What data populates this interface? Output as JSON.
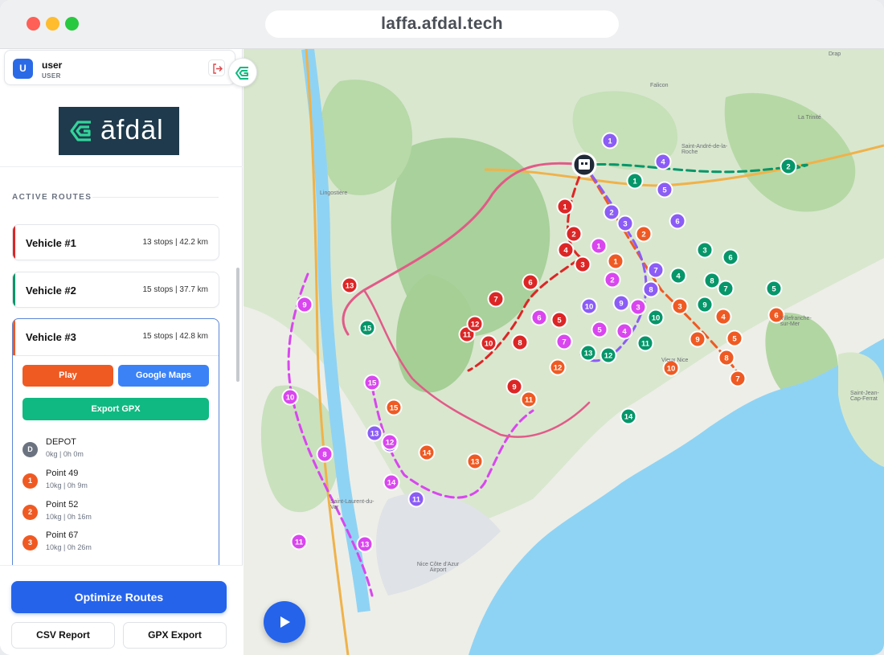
{
  "browser": {
    "url": "laffa.afdal.tech"
  },
  "user": {
    "initial": "U",
    "name": "user",
    "role": "USER"
  },
  "logo": {
    "text": "āfdāl"
  },
  "sidebar": {
    "section_title": "ACTIVE ROUTES",
    "routes": [
      {
        "name": "Vehicle #1",
        "meta": "13 stops | 42.2 km",
        "color": "#dc2626"
      },
      {
        "name": "Vehicle #2",
        "meta": "15 stops | 37.7 km",
        "color": "#059669"
      },
      {
        "name": "Vehicle #3",
        "meta": "15 stops | 42.8 km",
        "color": "#ef5a23"
      }
    ],
    "expanded": {
      "play_label": "Play",
      "gmaps_label": "Google Maps",
      "export_label": "Export GPX",
      "stops": [
        {
          "badge": "D",
          "name": "DEPOT",
          "detail": "0kg | 0h 0m",
          "color": "#6b7280"
        },
        {
          "badge": "1",
          "name": "Point 49",
          "detail": "10kg | 0h 9m",
          "color": "#ef5a23"
        },
        {
          "badge": "2",
          "name": "Point 52",
          "detail": "10kg | 0h 16m",
          "color": "#ef5a23"
        },
        {
          "badge": "3",
          "name": "Point 67",
          "detail": "10kg | 0h 26m",
          "color": "#ef5a23"
        }
      ]
    }
  },
  "actions": {
    "optimize_label": "Optimize Routes",
    "csv_label": "CSV Report",
    "gpx_label": "GPX Export"
  },
  "map": {
    "labels": [
      "Drap",
      "Falicon",
      "Saint-André-de-la-Roche",
      "La Trinité",
      "Lingostière",
      "Villefranche-sur-Mer",
      "Saint-Jean-Cap-Ferrat",
      "Nice Côte d'Azur Airport",
      "Saint-Laurent-du-Var",
      "Vieux Nice"
    ],
    "colors": {
      "red": "#dc2626",
      "green": "#059669",
      "orange": "#ef5a23",
      "purple": "#8b5cf6",
      "magenta": "#d946ef",
      "sea": "#8fd3f4"
    },
    "markers": [
      {
        "n": "1",
        "c": "red"
      },
      {
        "n": "2",
        "c": "red"
      },
      {
        "n": "3",
        "c": "red"
      },
      {
        "n": "4",
        "c": "red"
      },
      {
        "n": "5",
        "c": "red"
      },
      {
        "n": "6",
        "c": "red"
      },
      {
        "n": "7",
        "c": "red"
      },
      {
        "n": "8",
        "c": "red"
      },
      {
        "n": "9",
        "c": "red"
      },
      {
        "n": "10",
        "c": "red"
      },
      {
        "n": "11",
        "c": "red"
      },
      {
        "n": "12",
        "c": "red"
      },
      {
        "n": "13",
        "c": "red"
      },
      {
        "n": "1",
        "c": "green"
      },
      {
        "n": "2",
        "c": "green"
      },
      {
        "n": "3",
        "c": "green"
      },
      {
        "n": "4",
        "c": "green"
      },
      {
        "n": "5",
        "c": "green"
      },
      {
        "n": "6",
        "c": "green"
      },
      {
        "n": "7",
        "c": "green"
      },
      {
        "n": "8",
        "c": "green"
      },
      {
        "n": "9",
        "c": "green"
      },
      {
        "n": "10",
        "c": "green"
      },
      {
        "n": "11",
        "c": "green"
      },
      {
        "n": "12",
        "c": "green"
      },
      {
        "n": "13",
        "c": "green"
      },
      {
        "n": "14",
        "c": "green"
      },
      {
        "n": "15",
        "c": "green"
      },
      {
        "n": "1",
        "c": "orange"
      },
      {
        "n": "2",
        "c": "orange"
      },
      {
        "n": "3",
        "c": "orange"
      },
      {
        "n": "4",
        "c": "orange"
      },
      {
        "n": "5",
        "c": "orange"
      },
      {
        "n": "6",
        "c": "orange"
      },
      {
        "n": "7",
        "c": "orange"
      },
      {
        "n": "8",
        "c": "orange"
      },
      {
        "n": "9",
        "c": "orange"
      },
      {
        "n": "10",
        "c": "orange"
      },
      {
        "n": "11",
        "c": "orange"
      },
      {
        "n": "12",
        "c": "orange"
      },
      {
        "n": "13",
        "c": "orange"
      },
      {
        "n": "14",
        "c": "orange"
      },
      {
        "n": "15",
        "c": "orange"
      },
      {
        "n": "1",
        "c": "purple"
      },
      {
        "n": "2",
        "c": "purple"
      },
      {
        "n": "3",
        "c": "purple"
      },
      {
        "n": "4",
        "c": "purple"
      },
      {
        "n": "5",
        "c": "purple"
      },
      {
        "n": "6",
        "c": "purple"
      },
      {
        "n": "7",
        "c": "purple"
      },
      {
        "n": "8",
        "c": "purple"
      },
      {
        "n": "9",
        "c": "purple"
      },
      {
        "n": "10",
        "c": "purple"
      },
      {
        "n": "11",
        "c": "purple"
      },
      {
        "n": "12",
        "c": "purple"
      },
      {
        "n": "13",
        "c": "purple"
      },
      {
        "n": "1",
        "c": "magenta"
      },
      {
        "n": "2",
        "c": "magenta"
      },
      {
        "n": "3",
        "c": "magenta"
      },
      {
        "n": "4",
        "c": "magenta"
      },
      {
        "n": "5",
        "c": "magenta"
      },
      {
        "n": "6",
        "c": "magenta"
      },
      {
        "n": "7",
        "c": "magenta"
      },
      {
        "n": "8",
        "c": "magenta"
      },
      {
        "n": "9",
        "c": "magenta"
      },
      {
        "n": "10",
        "c": "magenta"
      },
      {
        "n": "11",
        "c": "magenta"
      },
      {
        "n": "12",
        "c": "magenta"
      },
      {
        "n": "13",
        "c": "magenta"
      },
      {
        "n": "14",
        "c": "magenta"
      },
      {
        "n": "15",
        "c": "magenta"
      }
    ]
  }
}
